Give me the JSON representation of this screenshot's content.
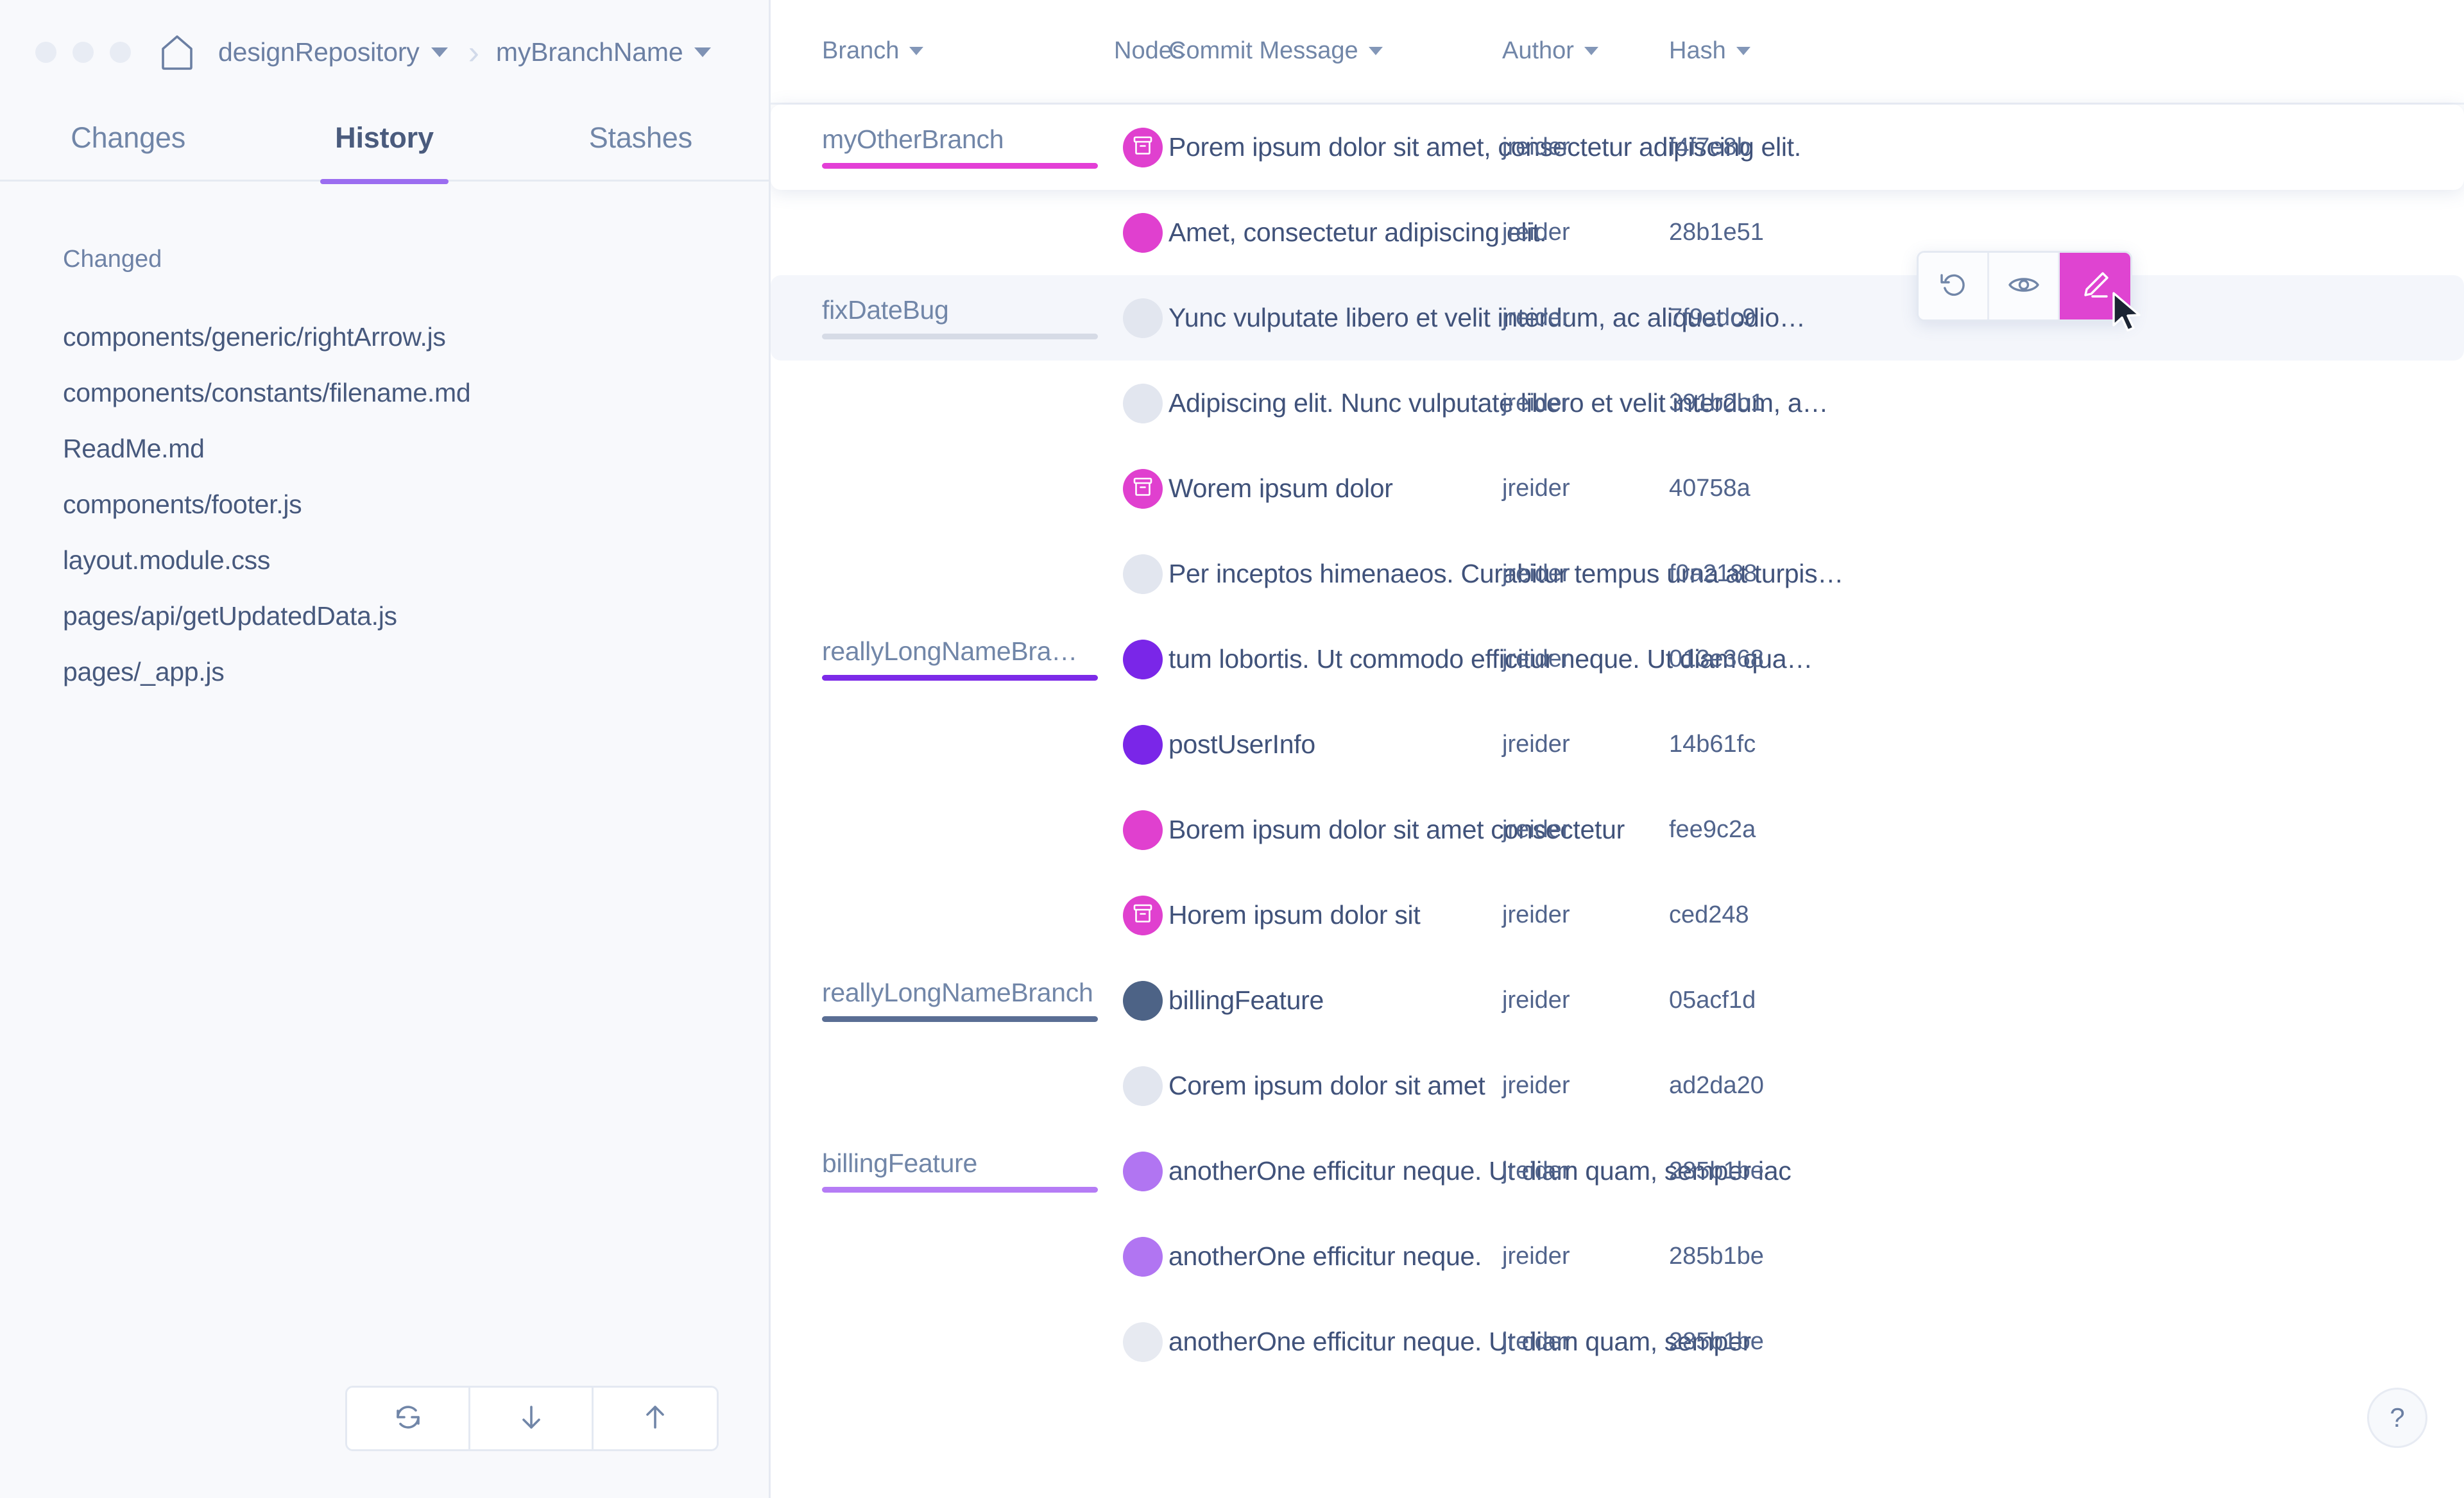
{
  "window": {
    "dots_count": 3,
    "home_icon": "home-icon"
  },
  "breadcrumb": {
    "repository": "designRepository",
    "branch": "myBranchName",
    "separator": "›"
  },
  "tabs": [
    {
      "label": "Changes",
      "active": false
    },
    {
      "label": "History",
      "active": true
    },
    {
      "label": "Stashes",
      "active": false
    }
  ],
  "sidebar": {
    "section_title": "Changed",
    "files": [
      "components/generic/rightArrow.js",
      "components/constants/filename.md",
      "ReadMe.md",
      "components/footer.js",
      "layout.module.css",
      "pages/api/getUpdatedData.js",
      "pages/_app.js"
    ],
    "actions": [
      {
        "name": "fetch-button",
        "icon": "sync-icon"
      },
      {
        "name": "pull-button",
        "icon": "arrow-down-icon"
      },
      {
        "name": "push-button",
        "icon": "arrow-up-icon"
      }
    ]
  },
  "table": {
    "columns": [
      {
        "label": "Branch",
        "sortable": true
      },
      {
        "label": "Nodes",
        "sortable": false
      },
      {
        "label": "Commit Message",
        "sortable": true
      },
      {
        "label": "Author",
        "sortable": true
      },
      {
        "label": "Hash",
        "sortable": true
      }
    ],
    "rows": [
      {
        "branch": "myOtherBranch",
        "branch_color": "#e33fd6",
        "node_color": "#e040cf",
        "node_icon": "archive-icon",
        "message": "Porem ipsum dolor sit amet, consectetur adipiscing elit.",
        "author": "jreider",
        "hash": "f4f7e8b",
        "state": "selected"
      },
      {
        "branch": "",
        "branch_color": "",
        "node_color": "#e040cf",
        "node_icon": "",
        "message": "Amet, consectetur adipiscing elit.",
        "author": "jreider",
        "hash": "28b1e51",
        "state": "normal"
      },
      {
        "branch": "fixDateBug",
        "branch_color": "#d6dbe6",
        "node_color": "#e2e6ef",
        "node_icon": "",
        "message": "Yunc vulputate libero et velit interdum, ac aliquet odio…",
        "author": "jreider",
        "hash": "7f9adc9",
        "state": "hovered"
      },
      {
        "branch": "",
        "branch_color": "",
        "node_color": "#e2e6ef",
        "node_icon": "",
        "message": "Adipiscing elit. Nunc vulputate libero et velit interdum, a…",
        "author": "jreider",
        "hash": "391b2b1",
        "state": "normal"
      },
      {
        "branch": "",
        "branch_color": "",
        "node_color": "#e040cf",
        "node_icon": "archive-icon",
        "message": "Worem ipsum dolor",
        "author": "jreider",
        "hash": "40758a",
        "state": "normal"
      },
      {
        "branch": "",
        "branch_color": "",
        "node_color": "#e2e6ef",
        "node_icon": "",
        "message": "Per inceptos himenaeos. Curabitur tempus urna at turpis…",
        "author": "jreider",
        "hash": "f0a2188",
        "state": "normal"
      },
      {
        "branch": "reallyLongNameBra…",
        "branch_color": "#7c2ae8",
        "node_color": "#7a26e8",
        "node_icon": "",
        "message": "tum lobortis. Ut commodo efficitur neque. Ut diam qua…",
        "author": "jreider",
        "hash": "013e368",
        "state": "normal"
      },
      {
        "branch": "",
        "branch_color": "",
        "node_color": "#7a26e8",
        "node_icon": "",
        "message": "postUserInfo",
        "author": "jreider",
        "hash": "14b61fc",
        "state": "normal"
      },
      {
        "branch": "",
        "branch_color": "",
        "node_color": "#e040cf",
        "node_icon": "",
        "message": "Borem ipsum dolor sit amet consectetur",
        "author": "jreider",
        "hash": "fee9c2a",
        "state": "normal"
      },
      {
        "branch": "",
        "branch_color": "",
        "node_color": "#e040cf",
        "node_icon": "archive-icon",
        "message": "Horem ipsum dolor sit",
        "author": "jreider",
        "hash": "ced248",
        "state": "normal"
      },
      {
        "branch": "reallyLongNameBranch",
        "branch_color": "#5a6e94",
        "node_color": "#4d6386",
        "node_icon": "",
        "message": "billingFeature",
        "author": "jreider",
        "hash": "05acf1d",
        "state": "normal"
      },
      {
        "branch": "",
        "branch_color": "",
        "node_color": "#e2e6ef",
        "node_icon": "",
        "message": "Corem ipsum dolor sit amet",
        "author": "jreider",
        "hash": "ad2da20",
        "state": "normal"
      },
      {
        "branch": "billingFeature",
        "branch_color": "#b57cf5",
        "node_color": "#b175f2",
        "node_icon": "",
        "message": "anotherOne efficitur neque. Ut diam quam, semper iac",
        "author": "jreider",
        "hash": "285b1be",
        "state": "normal"
      },
      {
        "branch": "",
        "branch_color": "",
        "node_color": "#b175f2",
        "node_icon": "",
        "message": "anotherOne efficitur neque.",
        "author": "jreider",
        "hash": "285b1be",
        "state": "normal"
      },
      {
        "branch": "",
        "branch_color": "",
        "node_color": "#e7eaf1",
        "node_icon": "",
        "message": "anotherOne efficitur neque. Ut diam quam, semper",
        "author": "jreider",
        "hash": "285b1be",
        "state": "normal"
      }
    ]
  },
  "node_popover": {
    "buttons": [
      {
        "name": "revert-button",
        "icon": "undo-icon",
        "accent": false
      },
      {
        "name": "view-button",
        "icon": "eye-icon",
        "accent": false
      },
      {
        "name": "edit-button",
        "icon": "pencil-icon",
        "accent": true
      }
    ],
    "accent_color": "#df44d1"
  },
  "help": {
    "label": "?"
  },
  "theme": {
    "accent_purple": "#9b6df0",
    "accent_magenta": "#e040cf",
    "text_primary": "#40527a",
    "text_muted": "#7186a8",
    "sidebar_bg": "#f8f9fc"
  }
}
